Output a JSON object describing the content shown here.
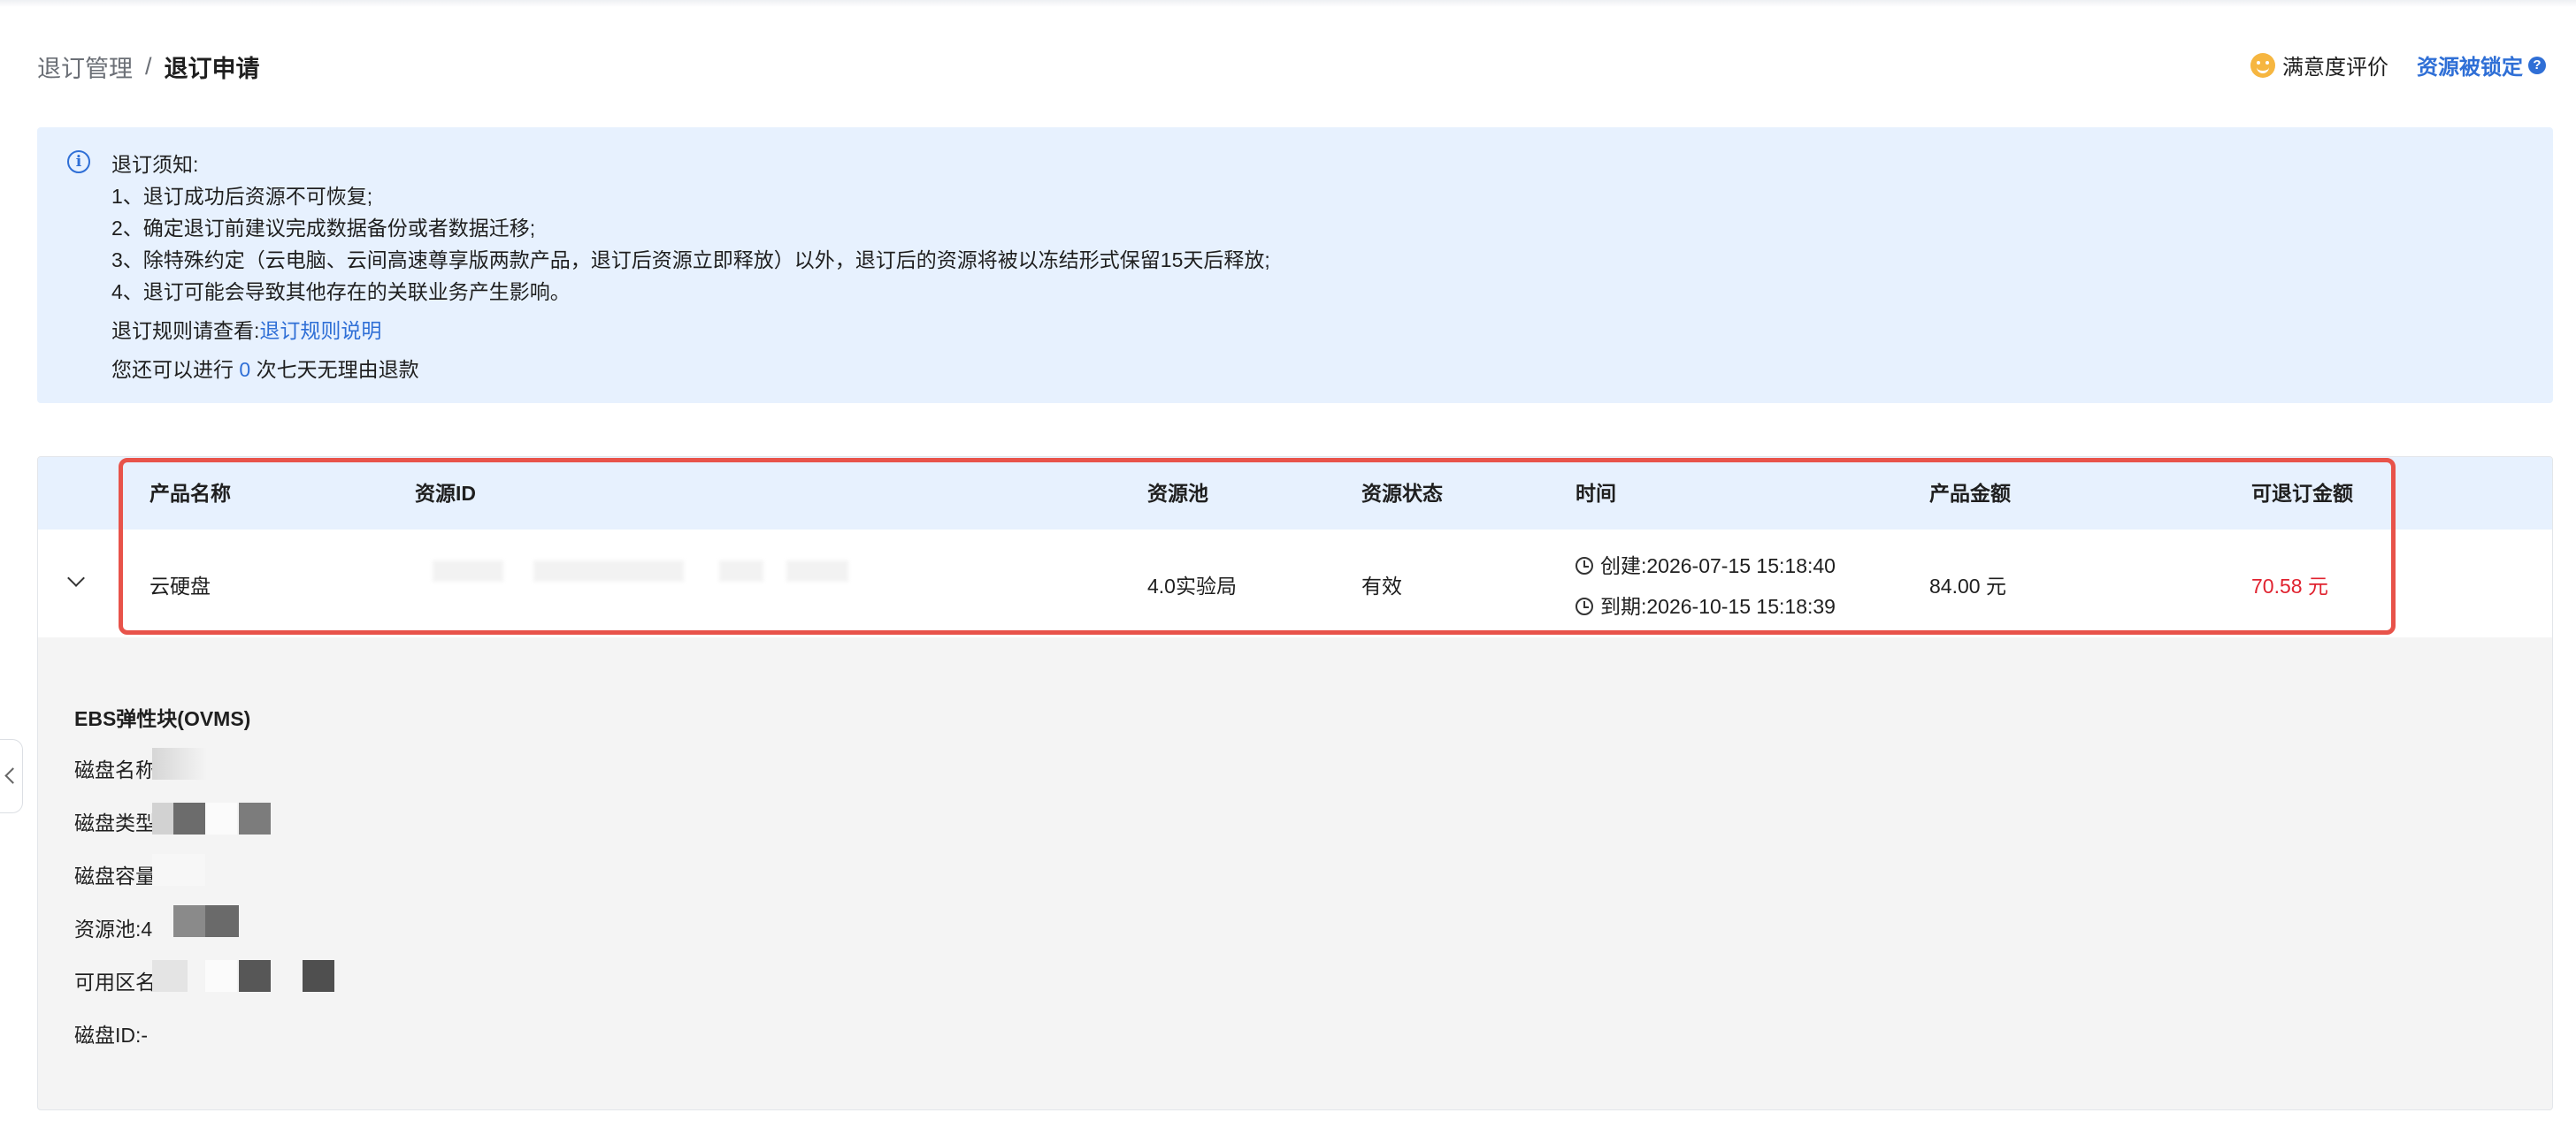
{
  "breadcrumb": {
    "parent": "退订管理",
    "separator": "/",
    "current": "退订申请"
  },
  "header": {
    "satisfaction": "满意度评价",
    "locked": "资源被锁定"
  },
  "notice": {
    "title": "退订须知:",
    "items": [
      "1、退订成功后资源不可恢复;",
      "2、确定退订前建议完成数据备份或者数据迁移;",
      "3、除特殊约定（云电脑、云间高速尊享版两款产品，退订后资源立即释放）以外，退订后的资源将被以冻结形式保留15天后释放;",
      "4、退订可能会导致其他存在的关联业务产生影响。"
    ],
    "rule_prefix": "退订规则请查看:",
    "rule_link": "退订规则说明",
    "refund_prefix": "您还可以进行",
    "refund_count": "0",
    "refund_suffix": "次七天无理由退款"
  },
  "table": {
    "columns": [
      "产品名称",
      "资源ID",
      "资源池",
      "资源状态",
      "时间",
      "产品金额",
      "可退订金额"
    ],
    "row": {
      "product": "云硬盘",
      "resource_id": "",
      "pool": "4.0实验局",
      "status": "有效",
      "created": "创建:2026-07-15 15:18:40",
      "expires": "到期:2026-10-15 15:18:39",
      "amount": "84.00 元",
      "refundable": "70.58 元"
    }
  },
  "detail": {
    "title": "EBS弹性块(OVMS)",
    "disk_name": "磁盘名称",
    "disk_type": "磁盘类型",
    "disk_capacity": "磁盘容量",
    "pool": "资源池:4",
    "zone": "可用区名",
    "disk_id": "磁盘ID:-"
  },
  "colors": {
    "accent": "#2f6fd6",
    "danger": "#e0222f",
    "highlight": "#e8534a",
    "notice_bg": "#e7f1fe"
  }
}
